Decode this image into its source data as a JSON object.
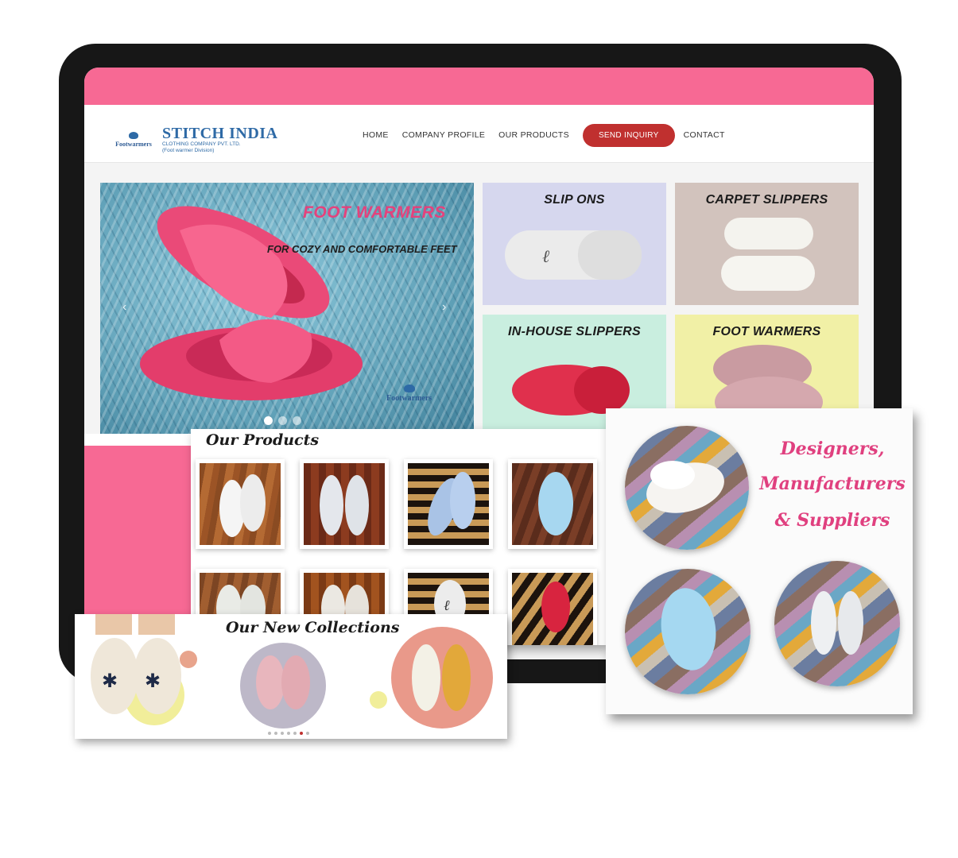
{
  "brand": {
    "logo_word": "Footwarmers",
    "name": "STITCH INDIA",
    "subtitle_line1": "CLOTHING COMPANY PVT. LTD.",
    "subtitle_line2": "(Foot warmer Division)"
  },
  "nav": {
    "items": [
      "HOME",
      "COMPANY PROFILE",
      "OUR PRODUCTS",
      "SEND INQUIRY",
      "CONTACT"
    ],
    "cta_color": "#c0302f"
  },
  "hero": {
    "title": "FOOT WARMERS",
    "tagline": "FOR COZY AND COMFORTABLE FEET",
    "watermark": "Footwarmers",
    "prev_icon": "chevron-left-icon",
    "next_icon": "chevron-right-icon",
    "slide_count": 3,
    "active_slide": 1
  },
  "categories": [
    {
      "label": "SLIP ONS",
      "bg": "#d6d7ee"
    },
    {
      "label": "CARPET SLIPPERS",
      "bg": "#d2c3bd"
    },
    {
      "label": "IN-HOUSE SLIPPERS",
      "bg": "#c9eedf"
    },
    {
      "label": "FOOT WARMERS",
      "bg": "#f1f0a6"
    }
  ],
  "products": {
    "heading": "Our Products"
  },
  "designers": {
    "line1": "Designers,",
    "line2": "Manufacturers",
    "line3": "& Suppliers"
  },
  "new_collections": {
    "heading": "Our New Collections",
    "slide_count": 7,
    "active_slide": 6
  },
  "colors": {
    "accent_pink": "#f76994",
    "script_pink": "#e0407f",
    "brand_blue": "#2e6aa6"
  }
}
